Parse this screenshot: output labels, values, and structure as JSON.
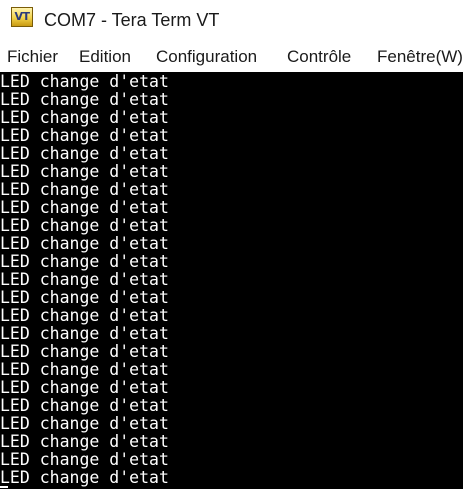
{
  "window": {
    "title": "COM7 - Tera Term VT",
    "icon": "tera-term-vt-icon",
    "icon_label": "VT"
  },
  "menu": {
    "items": [
      "Fichier",
      "Edition",
      "Configuration",
      "Contrôle",
      "Fenêtre(W)"
    ]
  },
  "terminal": {
    "background": "#000000",
    "foreground": "#ffffff",
    "lines": [
      "LED change d'etat",
      "LED change d'etat",
      "LED change d'etat",
      "LED change d'etat",
      "LED change d'etat",
      "LED change d'etat",
      "LED change d'etat",
      "LED change d'etat",
      "LED change d'etat",
      "LED change d'etat",
      "LED change d'etat",
      "LED change d'etat",
      "LED change d'etat",
      "LED change d'etat",
      "LED change d'etat",
      "LED change d'etat",
      "LED change d'etat",
      "LED change d'etat",
      "LED change d'etat",
      "LED change d'etat",
      "LED change d'etat",
      "LED change d'etat",
      "LED change d'etat"
    ]
  }
}
